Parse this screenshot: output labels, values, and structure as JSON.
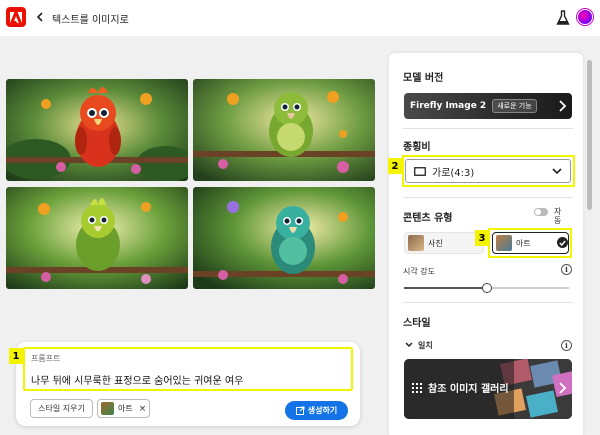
{
  "header": {
    "app_title": "텍스트를 이미지로"
  },
  "images": [
    {
      "alt": "red parrot"
    },
    {
      "alt": "green parrot"
    },
    {
      "alt": "yellow-green parrot"
    },
    {
      "alt": "teal parrot"
    }
  ],
  "prompt": {
    "label": "프롬프트",
    "text": "나무 뒤에 시무룩한 표정으로 숨어있는 귀여운 여우",
    "clear_style_label": "스타일 지우기",
    "style_chip_label": "아트",
    "style_chip_remove": "×",
    "generate_label": "생성하기"
  },
  "callouts": {
    "one": "1",
    "two": "2",
    "three": "3"
  },
  "panel": {
    "model_version_title": "모델 버전",
    "model_name": "Firefly Image 2",
    "model_badge": "새로운 기능",
    "aspect_ratio_title": "종횡비",
    "aspect_ratio_value": "가로(4:3)",
    "content_type_title": "콘텐츠 유형",
    "auto_label": "자동",
    "content_type_photo": "사진",
    "content_type_art": "아트",
    "visual_intensity_label": "시각 강도",
    "visual_intensity_value": 0.5,
    "style_title": "스타일",
    "match_label": "일치",
    "gallery_label": "참조 이미지 갤러리"
  },
  "colors": {
    "accent": "#1473e6",
    "brand": "#eb1000",
    "highlight": "#f4f400"
  },
  "icons": {
    "logo": "adobe-logo-icon",
    "back": "back-icon",
    "flask": "flask-icon",
    "avatar": "avatar",
    "chevron_right": "chevron-right-icon",
    "chevron_down": "chevron-down-icon",
    "landscape": "landscape-icon",
    "info": "info-icon",
    "generate": "generate-icon",
    "grid": "grid-icon"
  }
}
